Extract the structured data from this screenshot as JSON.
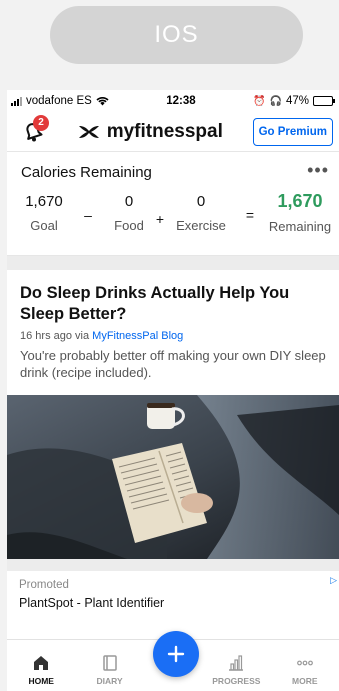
{
  "platform_label": "IOS",
  "status_bar": {
    "carrier": "vodafone ES",
    "time": "12:38",
    "battery": "47%",
    "battery_level": 0.47
  },
  "app_bar": {
    "notification_count": "2",
    "brand": "myfitnesspal",
    "premium_button": "Go Premium"
  },
  "calories": {
    "title": "Calories Remaining",
    "goal": {
      "value": "1,670",
      "label": "Goal"
    },
    "op_minus": "–",
    "food": {
      "value": "0",
      "label": "Food"
    },
    "op_plus": "+",
    "exercise": {
      "value": "0",
      "label": "Exercise"
    },
    "op_equals": "=",
    "remaining": {
      "value": "1,670",
      "label": "Remaining"
    },
    "accent_color": "#2e9b5d"
  },
  "article": {
    "title": "Do Sleep Drinks Actually Help You Sleep Better?",
    "time_ago": "16 hrs ago via ",
    "source": "MyFitnessPal Blog",
    "description": "You're probably better off making your own DIY sleep drink (recipe included)."
  },
  "promo": {
    "label": "Promoted",
    "name": "PlantSpot - Plant Identifier"
  },
  "tabs": [
    {
      "label": "HOME",
      "icon": "home-icon",
      "active": true
    },
    {
      "label": "DIARY",
      "icon": "book-icon",
      "active": false
    },
    {
      "label": "PROGRESS",
      "icon": "chart-icon",
      "active": false
    },
    {
      "label": "MORE",
      "icon": "more-dots-icon",
      "active": false
    }
  ],
  "colors": {
    "link_blue": "#0066ee",
    "fab_blue": "#1a6ef5",
    "badge_red": "#e23a3a"
  }
}
